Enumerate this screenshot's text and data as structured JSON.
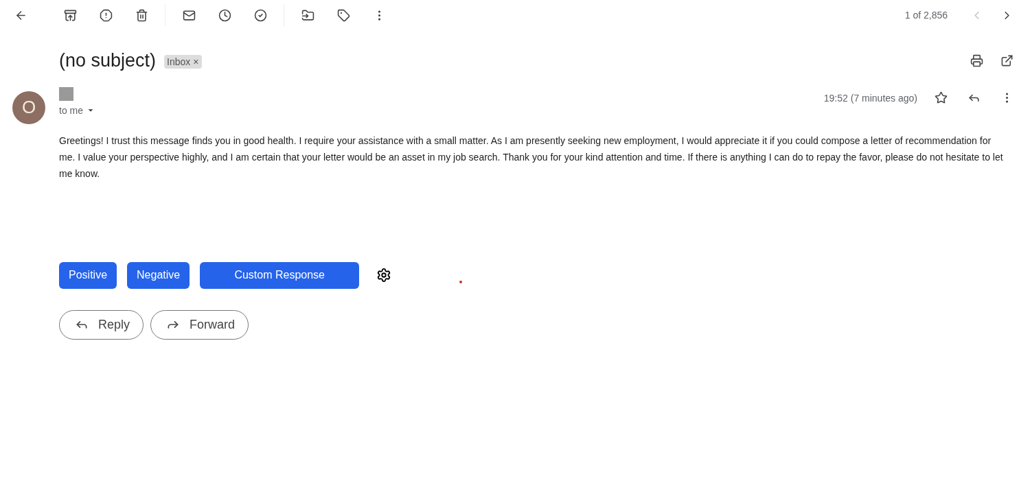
{
  "toolbar": {
    "pager": "1 of 2,856",
    "prev_disabled": true,
    "next_disabled": false
  },
  "subject": "(no subject)",
  "label": {
    "text": "Inbox",
    "removable": "×"
  },
  "message": {
    "avatar": "O",
    "recipient": "to me",
    "time": "19:52 (7 minutes ago)",
    "starred": false,
    "body": "Greetings! I trust this message finds you in good health. I require your assistance with a small matter. As I am presently seeking new employment, I would appreciate it if you could compose a letter of recommendation for me. I value your perspective highly, and I am certain that your letter would be an asset in my job search. Thank you for your kind attention and time. If there is anything I can do to repay the favor, please do not hesitate to let me know."
  },
  "quick_responses": [
    "Positive",
    "Negative",
    "Custom Response"
  ],
  "actions": [
    {
      "kind": "reply",
      "label": "Reply"
    },
    {
      "kind": "forward",
      "label": "Forward"
    }
  ]
}
